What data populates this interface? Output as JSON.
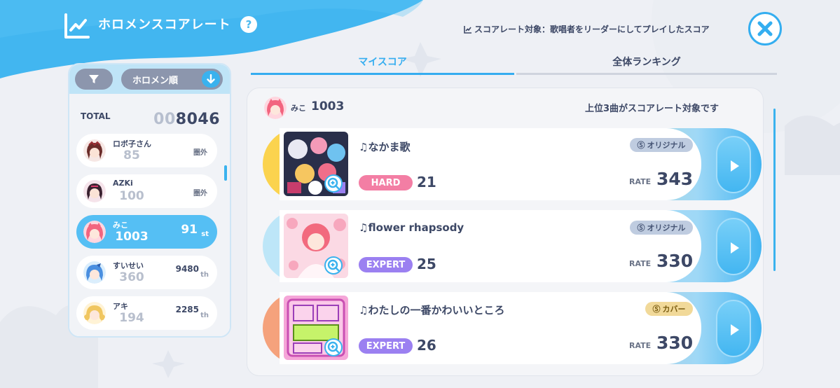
{
  "header": {
    "title": "ホロメンスコアレート",
    "help": "?",
    "target_info": "スコアレート対象：歌唱者をリーダーにしてプレイしたスコア"
  },
  "sidebar": {
    "sort_label": "ホロメン順",
    "total_label": "TOTAL",
    "total_prefix": "00",
    "total_value": "8046",
    "members": [
      {
        "name": "ロボ子さん",
        "score": "85",
        "rank": "圏外"
      },
      {
        "name": "AZKi",
        "score": "100",
        "rank": "圏外"
      },
      {
        "name": "みこ",
        "score": "1003",
        "rank_num": "91",
        "rank_suffix": "st"
      },
      {
        "name": "すいせい",
        "score": "360",
        "rank_num": "9480",
        "rank_suffix": "th"
      },
      {
        "name": "アキ",
        "score": "194",
        "rank_num": "2285",
        "rank_suffix": "th"
      }
    ]
  },
  "tabs": {
    "my_score": "マイスコア",
    "ranking": "全体ランキング"
  },
  "main": {
    "member_name": "みこ",
    "member_score": "1003",
    "note": "上位3曲がスコアレート対象です",
    "songs": [
      {
        "title": "なかま歌",
        "tag": "オリジナル",
        "difficulty": "HARD",
        "level": "21",
        "rate_label": "RATE",
        "rate": "343"
      },
      {
        "title": "flower rhapsody",
        "tag": "オリジナル",
        "difficulty": "EXPERT",
        "level": "25",
        "rate_label": "RATE",
        "rate": "330"
      },
      {
        "title": "わたしの一番かわいいところ",
        "tag": "カバー",
        "difficulty": "EXPERT",
        "level": "26",
        "rate_label": "RATE",
        "rate": "330"
      }
    ]
  },
  "colors": {
    "accent": "#35adf0",
    "hard": "#f37ea4",
    "expert": "#9b80f1",
    "text": "#3d4866"
  }
}
